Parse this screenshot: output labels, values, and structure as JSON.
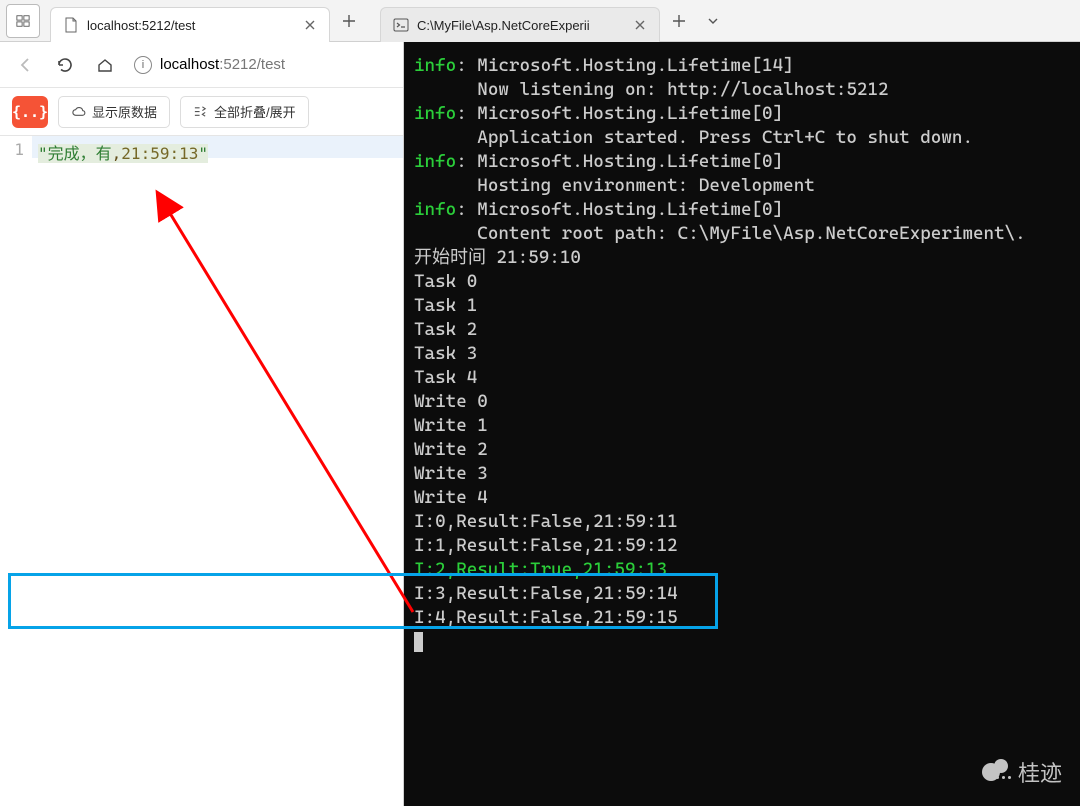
{
  "tabs": {
    "browser": {
      "title": "localhost:5212/test"
    },
    "terminal": {
      "title": "C:\\MyFile\\Asp.NetCoreExperii"
    }
  },
  "address": {
    "host": "localhost",
    "port": ":5212",
    "path": "/test"
  },
  "toolbar": {
    "badge": "{..}",
    "show_raw": "显示原数据",
    "collapse_expand": "全部折叠/展开"
  },
  "json_view": {
    "line_no": "1",
    "quote_open": "\"",
    "text_prefix": "完成，有",
    "comma": ",",
    "time": "21:59:13",
    "quote_close": "\""
  },
  "terminal": {
    "lines": [
      {
        "cls": "info-line",
        "tag": "info",
        "msg": "Microsoft.Hosting.Lifetime[14]"
      },
      {
        "cls": "cont",
        "msg": "Now listening on: http://localhost:5212"
      },
      {
        "cls": "info-line",
        "tag": "info",
        "msg": "Microsoft.Hosting.Lifetime[0]"
      },
      {
        "cls": "cont",
        "msg": "Application started. Press Ctrl+C to shut down."
      },
      {
        "cls": "info-line",
        "tag": "info",
        "msg": "Microsoft.Hosting.Lifetime[0]"
      },
      {
        "cls": "cont",
        "msg": "Hosting environment: Development"
      },
      {
        "cls": "info-line",
        "tag": "info",
        "msg": "Microsoft.Hosting.Lifetime[0]"
      },
      {
        "cls": "cont",
        "msg": "Content root path: C:\\MyFile\\Asp.NetCoreExperiment\\."
      },
      {
        "cls": "plain",
        "msg": "开始时间 21:59:10"
      },
      {
        "cls": "plain",
        "msg": "Task 0"
      },
      {
        "cls": "plain",
        "msg": "Task 1"
      },
      {
        "cls": "plain",
        "msg": "Task 2"
      },
      {
        "cls": "plain",
        "msg": "Task 3"
      },
      {
        "cls": "plain",
        "msg": "Task 4"
      },
      {
        "cls": "plain",
        "msg": "Write 0"
      },
      {
        "cls": "plain",
        "msg": "Write 1"
      },
      {
        "cls": "plain",
        "msg": "Write 2"
      },
      {
        "cls": "plain",
        "msg": "Write 3"
      },
      {
        "cls": "plain",
        "msg": "Write 4"
      },
      {
        "cls": "plain",
        "msg": "I:0,Result:False,21:59:11"
      },
      {
        "cls": "plain",
        "msg": "I:1,Result:False,21:59:12"
      },
      {
        "cls": "green",
        "msg": "I:2,Result:True,21:59:13"
      },
      {
        "cls": "plain",
        "msg": "I:3,Result:False,21:59:14"
      },
      {
        "cls": "plain",
        "msg": "I:4,Result:False,21:59:15"
      }
    ]
  },
  "watermark": {
    "text": "桂迹"
  }
}
